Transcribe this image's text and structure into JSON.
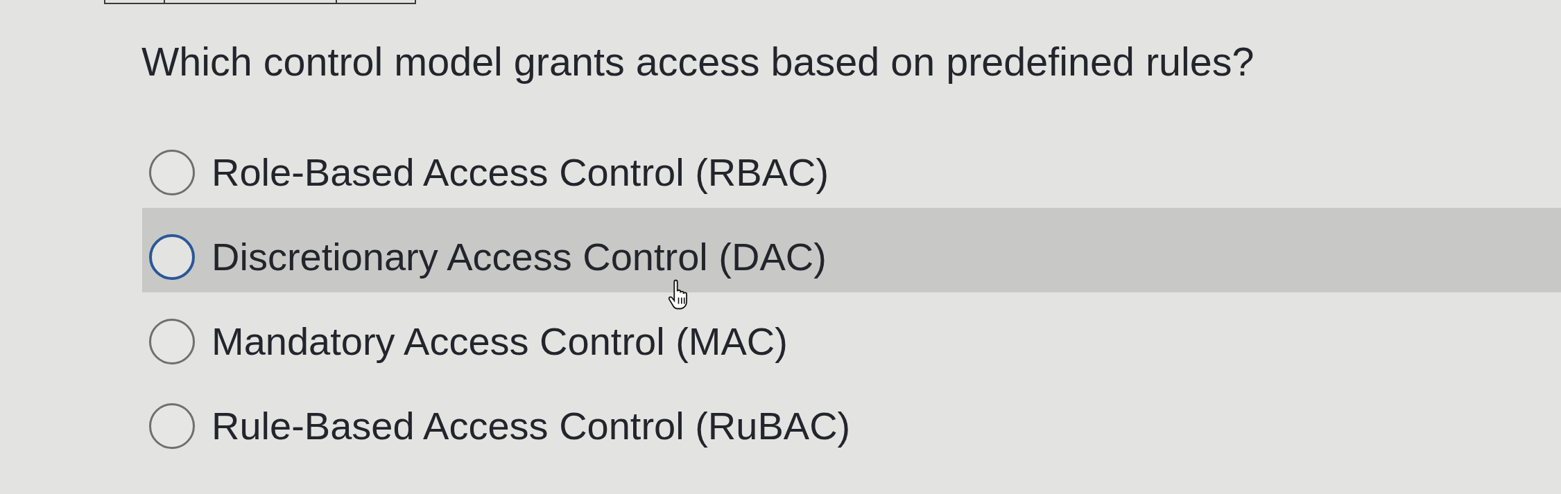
{
  "question": {
    "text": "Which control model grants access based on predefined rules?"
  },
  "options": [
    {
      "label": "Role-Based Access Control (RBAC)",
      "selected": false,
      "hovered": false
    },
    {
      "label": "Discretionary Access Control (DAC)",
      "selected": false,
      "hovered": true
    },
    {
      "label": "Mandatory Access Control (MAC)",
      "selected": false,
      "hovered": false
    },
    {
      "label": "Rule-Based Access Control (RuBAC)",
      "selected": false,
      "hovered": false
    }
  ]
}
